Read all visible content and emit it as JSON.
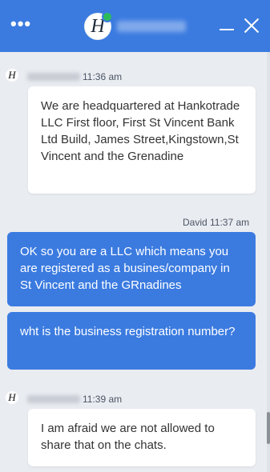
{
  "header": {
    "logo_letter": "H",
    "menu_icon": "more-dots-icon",
    "minimize_icon": "minimize-icon",
    "close_icon": "close-icon",
    "accent": "#3b7be0",
    "online_color": "#2dbb5a"
  },
  "messages": [
    {
      "sender": "agent",
      "time": "11:36 am",
      "text": "We are headquartered at Hankotrade LLC First floor, First St Vincent Bank Ltd Build, James Street,Kingstown,St Vincent and the Grenadine"
    },
    {
      "sender": "user",
      "meta": "David 11:37 am",
      "text1": "OK so you are a LLC which means you are registered as a busines/company in St Vincent and the GRnadines",
      "text2": "wht is the business registration number?"
    },
    {
      "sender": "agent",
      "time": "11:39 am",
      "text": "I am afraid we are not allowed to share that on the chats."
    }
  ]
}
